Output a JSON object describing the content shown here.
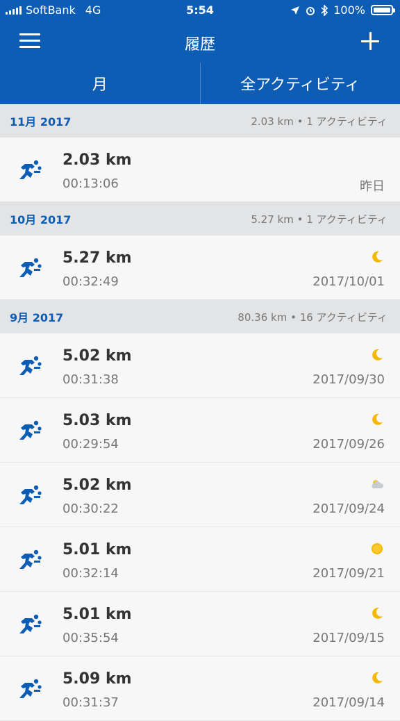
{
  "status_bar": {
    "carrier": "SoftBank",
    "network": "4G",
    "time": "5:54",
    "battery": "100%"
  },
  "header": {
    "title": "履歴",
    "menu_icon": "hamburger-menu-icon",
    "add_icon": "plus-icon",
    "background_color": "#0d5db5"
  },
  "tabs": [
    {
      "label": "月"
    },
    {
      "label": "全アクティビティ"
    }
  ],
  "sections": [
    {
      "month": "11月 2017",
      "summary": "2.03 km • 1 アクティビティ",
      "rows": [
        {
          "distance": "2.03 km",
          "duration": "00:13:06",
          "date": "昨日",
          "weather": ""
        }
      ]
    },
    {
      "month": "10月 2017",
      "summary": "5.27 km • 1 アクティビティ",
      "rows": [
        {
          "distance": "5.27 km",
          "duration": "00:32:49",
          "date": "2017/10/01",
          "weather": "moon"
        }
      ]
    },
    {
      "month": "9月 2017",
      "summary": "80.36 km • 16 アクティビティ",
      "rows": [
        {
          "distance": "5.02 km",
          "duration": "00:31:38",
          "date": "2017/09/30",
          "weather": "moon"
        },
        {
          "distance": "5.03 km",
          "duration": "00:29:54",
          "date": "2017/09/26",
          "weather": "moon"
        },
        {
          "distance": "5.02 km",
          "duration": "00:30:22",
          "date": "2017/09/24",
          "weather": "cloud"
        },
        {
          "distance": "5.01 km",
          "duration": "00:32:14",
          "date": "2017/09/21",
          "weather": "sun"
        },
        {
          "distance": "5.01 km",
          "duration": "00:35:54",
          "date": "2017/09/15",
          "weather": "moon"
        },
        {
          "distance": "5.09 km",
          "duration": "00:31:37",
          "date": "2017/09/14",
          "weather": "moon"
        }
      ]
    }
  ]
}
